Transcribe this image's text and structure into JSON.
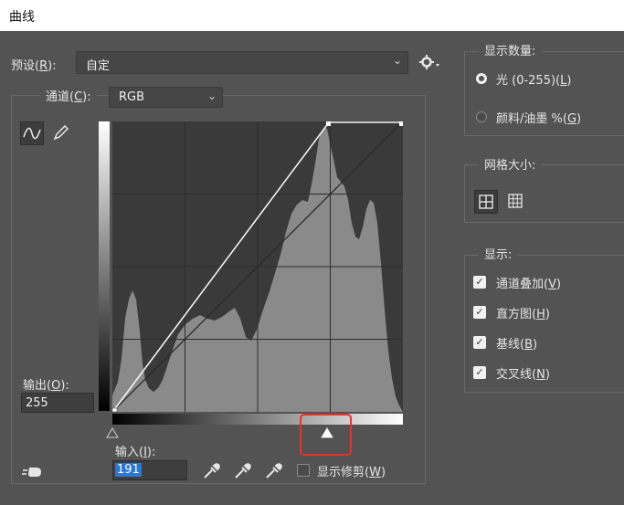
{
  "window": {
    "title": "曲线"
  },
  "preset": {
    "label": "预设(",
    "key": "R",
    "suffix": "):",
    "value": "自定"
  },
  "channel": {
    "label": "通道(",
    "key": "C",
    "suffix": "):",
    "value": "RGB"
  },
  "display_amount": {
    "legend": "显示数量:",
    "options": [
      {
        "text": "光 (0-255)(",
        "key": "L",
        "suffix": ")",
        "selected": true
      },
      {
        "text": "颜料/油墨 %(",
        "key": "G",
        "suffix": ")",
        "selected": false
      }
    ]
  },
  "grid_size": {
    "legend": "网格大小:"
  },
  "show": {
    "legend": "显示:",
    "items": [
      {
        "text": "通道叠加(",
        "key": "V",
        "suffix": ")",
        "checked": true
      },
      {
        "text": "直方图(",
        "key": "H",
        "suffix": ")",
        "checked": true
      },
      {
        "text": "基线(",
        "key": "B",
        "suffix": ")",
        "checked": true
      },
      {
        "text": "交叉线(",
        "key": "N",
        "suffix": ")",
        "checked": true
      }
    ]
  },
  "output": {
    "label": "输出(",
    "key": "O",
    "suffix": "):",
    "value": "255"
  },
  "input": {
    "label": "输入(",
    "key": "I",
    "suffix": "):",
    "value": "191"
  },
  "show_clipping": {
    "text": "显示修剪(",
    "key": "W",
    "suffix": ")",
    "checked": false
  },
  "colors": {
    "highlight": "#e8312b",
    "selection": "#2a78d0"
  }
}
